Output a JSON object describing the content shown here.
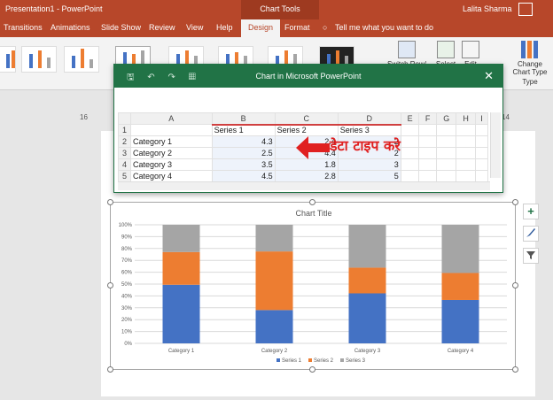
{
  "titlebar": {
    "doc_title": "Presentation1  -  PowerPoint",
    "context_tab": "Chart Tools",
    "user": "Lalita Sharma"
  },
  "tabs": [
    {
      "label": "Transitions",
      "active": false
    },
    {
      "label": "Animations",
      "active": false
    },
    {
      "label": "Slide Show",
      "active": false
    },
    {
      "label": "Review",
      "active": false
    },
    {
      "label": "View",
      "active": false
    },
    {
      "label": "Help",
      "active": false
    },
    {
      "label": "Design",
      "active": true
    },
    {
      "label": "Format",
      "active": false
    }
  ],
  "tellme": "Tell me what you want to do",
  "ribbon": {
    "switch_label": "Switch Row/",
    "select_label": "Select",
    "edit_label": "Edit",
    "change_chart_type_line1": "Change",
    "change_chart_type_line2": "Chart Type",
    "group_type": "Type"
  },
  "data_window": {
    "title": "Chart in Microsoft PowerPoint",
    "close": "✕",
    "columns": [
      "",
      "A",
      "B",
      "C",
      "D",
      "E",
      "F",
      "G",
      "H",
      "I"
    ],
    "rows": [
      {
        "n": "1",
        "cells": [
          "",
          "Series 1",
          "Series 2",
          "Series 3",
          "",
          "",
          "",
          "",
          ""
        ]
      },
      {
        "n": "2",
        "cells": [
          "Category 1",
          "4.3",
          "2.4",
          "2",
          "",
          "",
          "",
          "",
          ""
        ]
      },
      {
        "n": "3",
        "cells": [
          "Category 2",
          "2.5",
          "4.4",
          "2",
          "",
          "",
          "",
          "",
          ""
        ]
      },
      {
        "n": "4",
        "cells": [
          "Category 3",
          "3.5",
          "1.8",
          "3",
          "",
          "",
          "",
          "",
          ""
        ]
      },
      {
        "n": "5",
        "cells": [
          "Category 4",
          "4.5",
          "2.8",
          "5",
          "",
          "",
          "",
          "",
          ""
        ]
      }
    ]
  },
  "annotation": "डेटा  टाइप करे",
  "ruler": {
    "left": "16",
    "right": "14"
  },
  "side_buttons": {
    "add": "+",
    "style": "brush-icon",
    "filter": "filter-icon"
  },
  "colors": {
    "series1": "#4472c4",
    "series2": "#ed7d31",
    "series3": "#a5a5a5",
    "ppt": "#b7472a",
    "excel": "#217346"
  },
  "chart_data": {
    "type": "bar",
    "stacked": "100%",
    "title": "Chart Title",
    "categories": [
      "Category 1",
      "Category 2",
      "Category 3",
      "Category 4"
    ],
    "series": [
      {
        "name": "Series 1",
        "values": [
          4.3,
          2.5,
          3.5,
          4.5
        ]
      },
      {
        "name": "Series 2",
        "values": [
          2.4,
          4.4,
          1.8,
          2.8
        ]
      },
      {
        "name": "Series 3",
        "values": [
          2,
          2,
          3,
          5
        ]
      }
    ],
    "yticks": [
      "0%",
      "10%",
      "20%",
      "30%",
      "40%",
      "50%",
      "60%",
      "70%",
      "80%",
      "90%",
      "100%"
    ],
    "ylim": [
      0,
      100
    ],
    "grid": true,
    "legend": "bottom"
  }
}
